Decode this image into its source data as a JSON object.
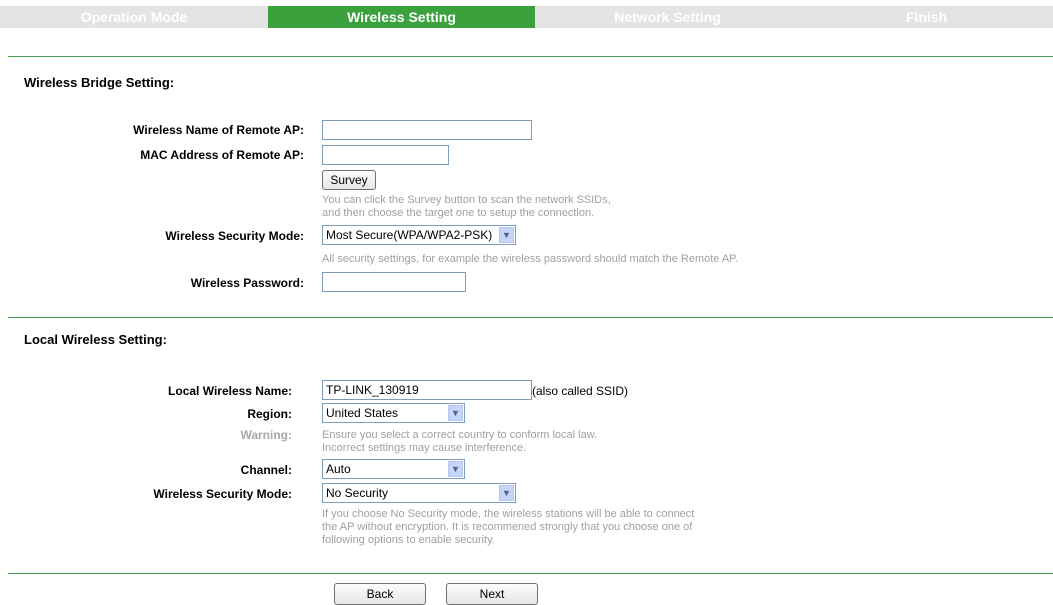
{
  "steps": [
    {
      "label": "Operation Mode",
      "active": false
    },
    {
      "label": "Wireless Setting",
      "active": true
    },
    {
      "label": "Network Setting",
      "active": false
    },
    {
      "label": "Finish",
      "active": false
    }
  ],
  "bridge": {
    "title": "Wireless Bridge Setting:",
    "remote_ap_name_label": "Wireless Name of Remote AP:",
    "remote_ap_name_value": "",
    "mac_label": "MAC Address of Remote AP:",
    "mac_value": "",
    "survey_button": "Survey",
    "survey_hint_1": "You can click the Survey button to scan the network SSIDs,",
    "survey_hint_2": "and then choose the target one to setup the connection.",
    "security_mode_label": "Wireless Security Mode:",
    "security_mode_value": "Most Secure(WPA/WPA2-PSK)",
    "security_hint": "All security settings, for example the wireless password should match the Remote AP.",
    "password_label": "Wireless Password:",
    "password_value": ""
  },
  "local": {
    "title": "Local Wireless Setting:",
    "name_label": "Local Wireless Name:",
    "name_value": "TP-LINK_130919",
    "name_note": "(also called SSID)",
    "region_label": "Region:",
    "region_value": "United States",
    "warning_label": "Warning:",
    "warning_line_1": "Ensure you select a correct country to conform local law.",
    "warning_line_2": "Incorrect settings may cause interference.",
    "channel_label": "Channel:",
    "channel_value": "Auto",
    "security_mode_label": "Wireless Security Mode:",
    "security_mode_value": "No Security",
    "security_hint_1": "If you choose No Security mode, the wireless stations will be able to connect",
    "security_hint_2": "the AP without encryption. It is recommened strongly that you choose one of",
    "security_hint_3": "following options to enable security."
  },
  "footer": {
    "back_button": "Back",
    "next_button": "Next"
  },
  "colors": {
    "active_step": "#3aa13c",
    "inactive_step": "#e4e4e4",
    "divider": "#4f9d55",
    "hint_text": "#a0a0a0"
  }
}
